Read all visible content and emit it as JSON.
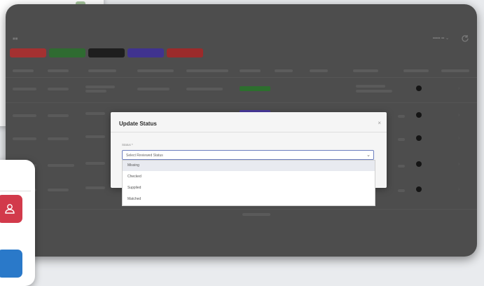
{
  "modal": {
    "title": "Update Status",
    "close_icon": "close-icon",
    "field_label": "Status *",
    "select": {
      "placeholder": "Select Reviewed Status",
      "chevron_icon": "chevron-down-icon"
    },
    "options": [
      "Missing",
      "Checked",
      "Supplied",
      "Matched"
    ]
  },
  "colors": {
    "tabs": [
      "#a43131",
      "#2f6b31",
      "#1e1e1e",
      "#40338f",
      "#9b2b2b"
    ],
    "badge_green": "#2d6e2e",
    "badge_purple": "#4a3aa0",
    "phone_red_icon": "#d23a4b",
    "phone_blue_icon": "#2a79c9"
  },
  "icons": {
    "refresh": "refresh-icon",
    "user": "user-icon"
  }
}
